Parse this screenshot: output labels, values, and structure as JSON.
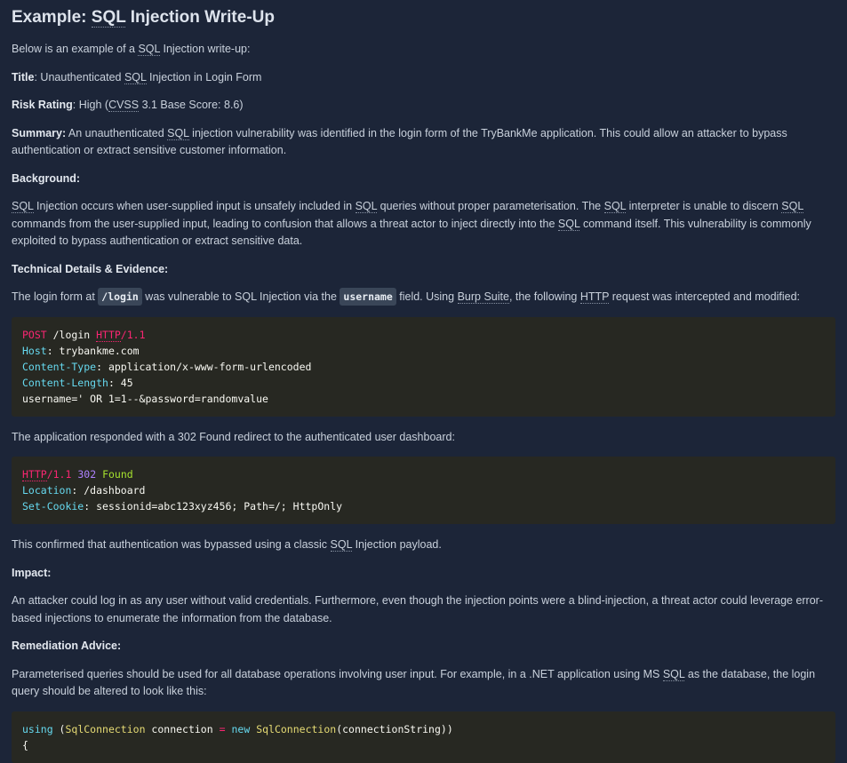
{
  "title_prefix": "Example: ",
  "title_abbr": "SQL",
  "title_suffix": " Injection Write-Up",
  "intro": {
    "before": "Below is an example of a ",
    "abbr": "SQL",
    "after": " Injection write-up:"
  },
  "title_field": {
    "label": "Title",
    "before": ": Unauthenticated ",
    "abbr": "SQL",
    "after": " Injection in Login Form"
  },
  "risk": {
    "label": "Risk Rating",
    "before": ": High (",
    "abbr": "CVSS",
    "after": " 3.1 Base Score: 8.6)"
  },
  "summary": {
    "label": "Summary:",
    "before": " An unauthenticated ",
    "abbr": "SQL",
    "after": " injection vulnerability was identified in the login form of the TryBankMe application. This could allow an attacker to bypass authentication or extract sensitive customer information."
  },
  "background_heading": "Background:",
  "background": {
    "a1": "SQL",
    "t1": " Injection occurs when user-supplied input is unsafely included in ",
    "a2": "SQL",
    "t2": " queries without proper parameterisation. The ",
    "a3": "SQL",
    "t3": " interpreter is unable to discern ",
    "a4": "SQL",
    "t4": " commands from the user-supplied input, leading to confusion that allows a threat actor to inject directly into the ",
    "a5": "SQL",
    "t5": " command itself. This vulnerability is commonly exploited to bypass authentication or extract sensitive data."
  },
  "technical_heading": "Technical Details & Evidence:",
  "technical": {
    "t1": "The login form at ",
    "code1": "/login",
    "t2": " was vulnerable to SQL Injection via the ",
    "code2": "username",
    "t3": " field. Using ",
    "a1": "Burp Suite",
    "t4": ", the following ",
    "a2": "HTTP",
    "t5": " request was intercepted and modified:"
  },
  "request": {
    "method": "POST",
    "path": " /login ",
    "proto": "HTTP",
    "ver": "/1.1",
    "h1": "Host",
    "v1": ": trybankme.com",
    "h2": "Content-Type",
    "v2": ": application/x-www-form-urlencoded",
    "h3": "Content-Length",
    "v3": ": 45",
    "body": "username=' OR 1=1--&password=randomvalue"
  },
  "responded": "The application responded with a 302 Found redirect to the authenticated user dashboard:",
  "response": {
    "proto": "HTTP",
    "ver": "/1.1",
    "code": "302",
    "status": "Found",
    "h1": "Location",
    "v1": ": /dashboard",
    "h2": "Set-Cookie",
    "v2": ": sessionid=abc123xyz456; Path=/; HttpOnly"
  },
  "confirmed": {
    "before": "This confirmed that authentication was bypassed using a classic ",
    "abbr": "SQL",
    "after": " Injection payload."
  },
  "impact_heading": "Impact:",
  "impact": "An attacker could log in as any user without valid credentials. Furthermore, even though the injection points were a blind-injection, a threat actor could leverage error-based injections to enumerate the information from the database.",
  "remediation_heading": "Remediation Advice:",
  "remediation": {
    "before": "Parameterised queries should be used for all database operations involving user input. For example, in a .NET application using MS ",
    "abbr": "SQL",
    "after": " as the database, the login query should be altered to look like this:"
  },
  "csharp": {
    "kw1": "using",
    "p1": " (",
    "ty1": "SqlConnection",
    "v1": " connection ",
    "eq": "=",
    "sp": " ",
    "kw2": "new",
    "sp2": " ",
    "ty2": "SqlConnection",
    "p2": "(connectionString))",
    "brace": "{"
  }
}
